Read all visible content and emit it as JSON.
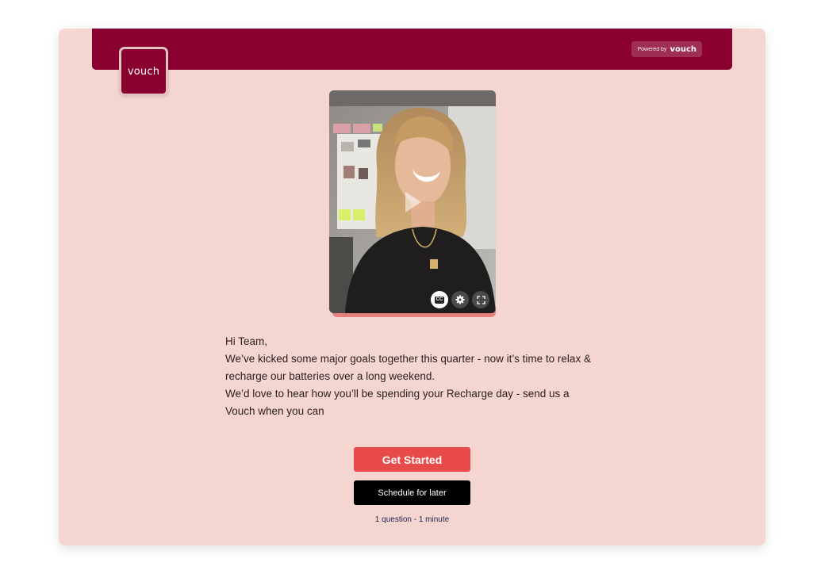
{
  "brand": {
    "logo_text": "vouch",
    "powered_by_label": "Powered by",
    "powered_by_brand": "vouch",
    "primary_color": "#8a0030",
    "background_color": "#f5d5d0"
  },
  "video": {
    "controls": {
      "captions_label": "CC",
      "captions_icon": "closed-captions-icon",
      "settings_icon": "gear-icon",
      "fullscreen_icon": "fullscreen-icon",
      "play_icon": "play-icon"
    }
  },
  "message": {
    "greeting": "Hi Team,",
    "line1": "We’ve kicked some major goals together this quarter - now it’s time to relax & recharge our batteries over a long weekend.",
    "line2": "We’d love to hear how you’ll be spending your Recharge day - send us a Vouch when you can"
  },
  "actions": {
    "get_started_label": "Get Started",
    "get_started_color": "#e84a4a",
    "schedule_label": "Schedule for later"
  },
  "meta": {
    "summary": "1 question - 1 minute"
  }
}
